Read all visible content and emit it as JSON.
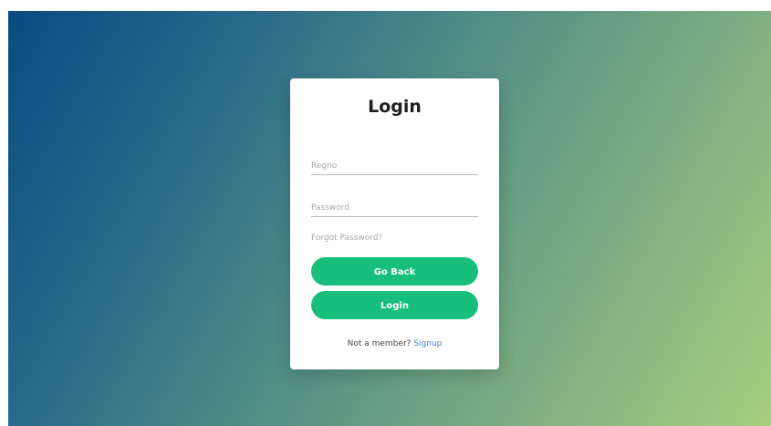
{
  "login": {
    "title": "Login",
    "regno_placeholder": "Regno",
    "password_placeholder": "Password",
    "forgot_label": "Forgot Password?",
    "go_back_label": "Go Back",
    "login_label": "Login",
    "member_prompt": "Not a member?",
    "signup_label": "Signup"
  },
  "colors": {
    "primary_button": "#17bf7a",
    "link": "#3b86d6",
    "background_start": "#0b4a82",
    "background_end": "#a6cf7e"
  }
}
